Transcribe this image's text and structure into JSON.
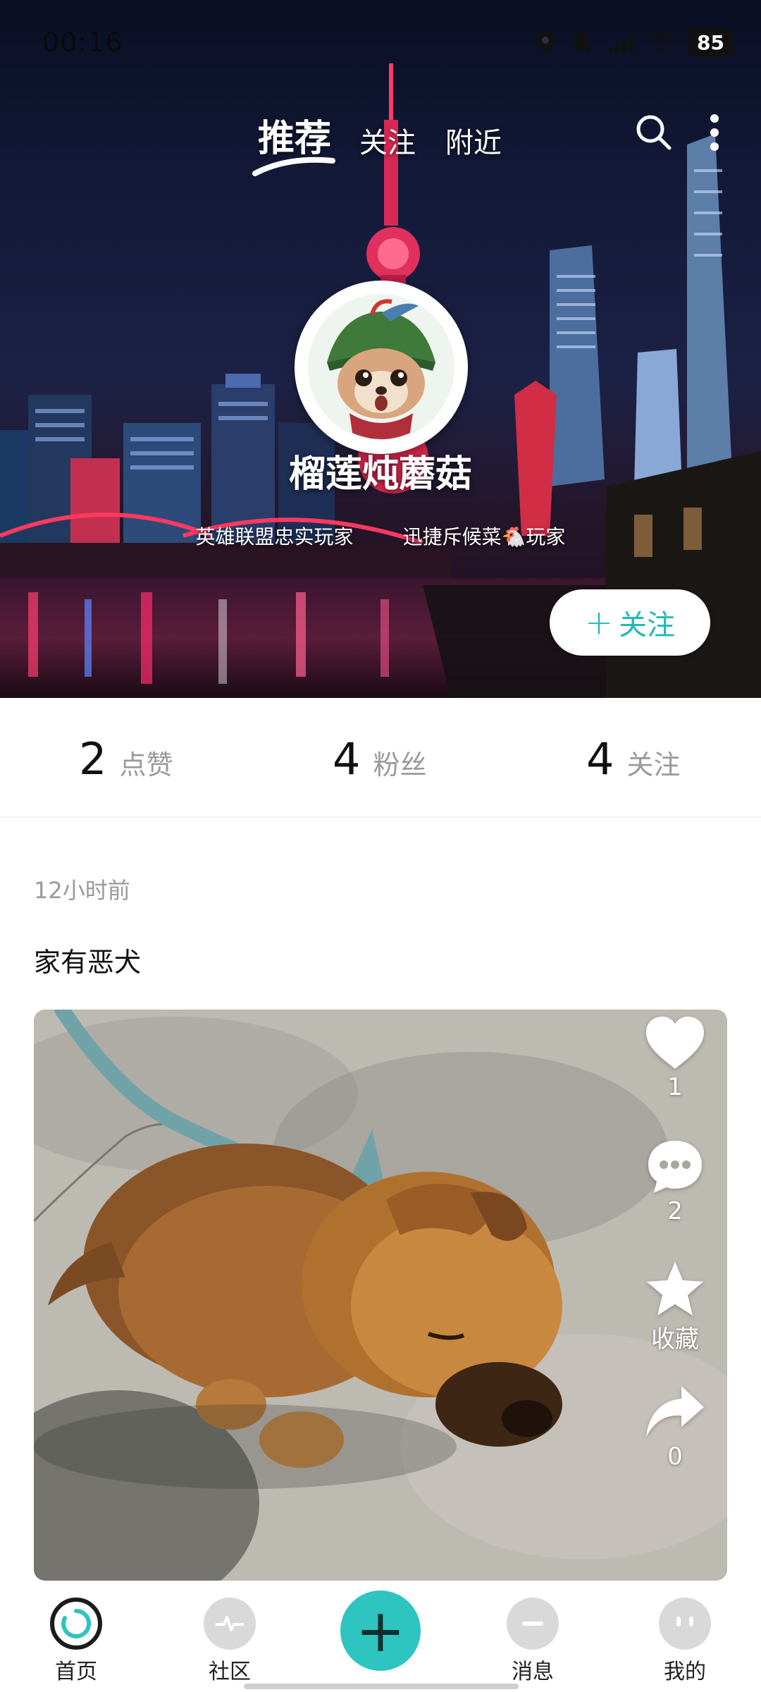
{
  "status_bar": {
    "time": "00:16",
    "battery": "85"
  },
  "top_tabs": [
    "推荐",
    "关注",
    "附近"
  ],
  "profile": {
    "name": "榴莲炖蘑菇",
    "tags": [
      "英雄联盟忠实玩家",
      "迅捷斥候菜🐔玩家"
    ],
    "follow_label": "关注",
    "follow_symbol": "+"
  },
  "stats": [
    {
      "value": "2",
      "label": "点赞"
    },
    {
      "value": "4",
      "label": "粉丝"
    },
    {
      "value": "4",
      "label": "关注"
    }
  ],
  "post": {
    "time": "12小时前",
    "text": "家有恶犬",
    "actions": {
      "likes": "1",
      "comments": "2",
      "collect": "收藏",
      "shares": "0"
    }
  },
  "bottom_nav": {
    "home": "首页",
    "community": "社区",
    "post_symbol": "+",
    "messages": "消息",
    "mine": "我的"
  },
  "colors": {
    "accent": "#2ec4c0",
    "follow_text": "#25b8b6"
  }
}
